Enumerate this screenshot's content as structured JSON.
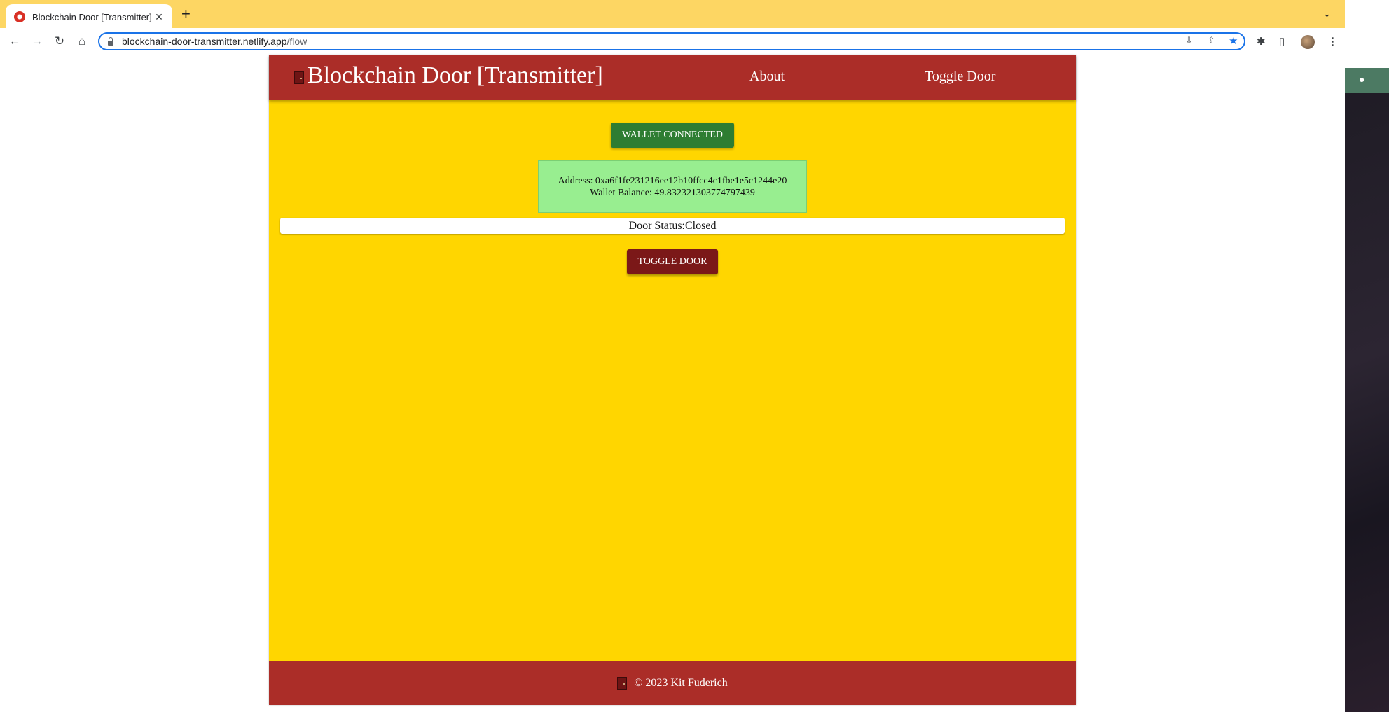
{
  "browser": {
    "tab_title": "Blockchain Door [Transmitter]",
    "tab_close": "✕",
    "new_tab": "+",
    "url_host": "blockchain-door-transmitter.netlify.app",
    "url_path": "/flow"
  },
  "icons": {
    "back": "arrow-left-icon",
    "forward": "arrow-right-icon",
    "reload": "reload-icon",
    "home": "home-icon",
    "star": "star-icon",
    "extensions": "puzzle-icon",
    "sidepanel": "side-panel-icon",
    "menu": "kebab-menu-icon",
    "door": "door-icon"
  },
  "header": {
    "title": "Blockchain Door [Transmitter]",
    "nav": [
      "About",
      "Toggle Door"
    ]
  },
  "wallet": {
    "button_label": "WALLET CONNECTED",
    "address_line": "Address: 0xa6f1fe231216ee12b10ffcc4c1fbe1e5c1244e20",
    "balance_line": "Wallet Balance: 49.832321303774797439"
  },
  "door": {
    "status_text": "Door Status:Closed",
    "toggle_label": "TOGGLE DOOR"
  },
  "footer": {
    "text": "© 2023 Kit Fuderich"
  },
  "colors": {
    "tabbar": "#fdd663",
    "header": "#ab2d28",
    "page_bg": "#ffd600",
    "wallet_button": "#2e7d32",
    "wallet_panel": "#98ee90",
    "toggle_button": "#7b1818"
  }
}
